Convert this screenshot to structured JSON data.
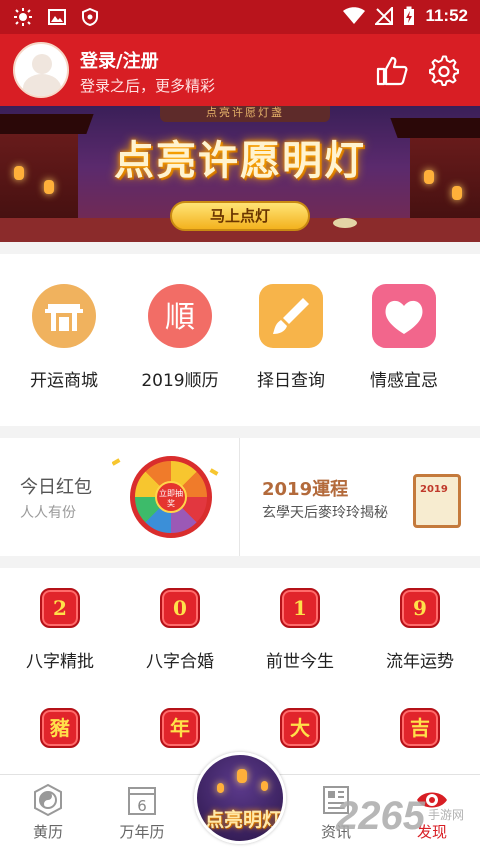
{
  "status_bar": {
    "time": "11:52"
  },
  "header": {
    "login_title": "登录/注册",
    "login_subtitle": "登录之后，更多精彩"
  },
  "banner": {
    "top_text": "点亮许愿灯盏",
    "title": "点亮许愿明灯",
    "button": "马上点灯"
  },
  "features": [
    {
      "label": "开运商城",
      "icon": "shop-gate-icon",
      "color": "#f0b25e"
    },
    {
      "label": "2019顺历",
      "icon": "almanac-icon",
      "color": "#f26d66"
    },
    {
      "label": "择日查询",
      "icon": "brush-icon",
      "color": "#f7b44a"
    },
    {
      "label": "情感宜忌",
      "icon": "heart-icon",
      "color": "#f2668c"
    }
  ],
  "cards": {
    "left_title": "今日红包",
    "left_subtitle": "人人有份",
    "wheel_text": "立即抽奖",
    "right_title": "2019運程",
    "right_subtitle": "玄學天后麥玲玲揭秘",
    "scroll_text": "2019"
  },
  "char_items": [
    {
      "char": "2",
      "label": "八字精批"
    },
    {
      "char": "0",
      "label": "八字合婚"
    },
    {
      "char": "1",
      "label": "前世今生"
    },
    {
      "char": "9",
      "label": "流年运势"
    },
    {
      "char": "豬",
      "label": ""
    },
    {
      "char": "年",
      "label": ""
    },
    {
      "char": "大",
      "label": ""
    },
    {
      "char": "吉",
      "label": ""
    }
  ],
  "bottom_nav": {
    "items": [
      {
        "label": "黄历",
        "icon": "yin-yang-icon"
      },
      {
        "label": "万年历",
        "icon": "calendar-icon",
        "day": "6"
      },
      {
        "label": "资讯",
        "icon": "news-icon"
      },
      {
        "label": "发现",
        "icon": "eye-icon",
        "active_color": "#d81e24"
      }
    ],
    "center_text": "点亮明灯"
  },
  "watermark": {
    "text": "2265",
    "sub": "手游网"
  }
}
